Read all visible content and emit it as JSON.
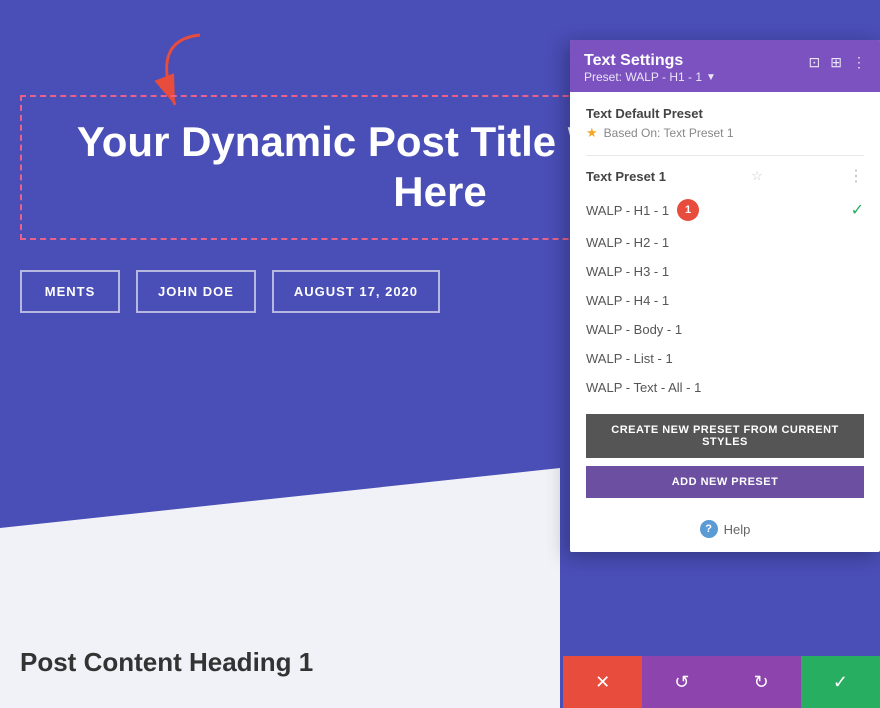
{
  "page": {
    "bg_color": "#4a4eb7"
  },
  "title": {
    "text": "Your Dynamic Post Title Will Display Here"
  },
  "meta": {
    "comments": "MENTS",
    "author": "JOHN DOE",
    "date": "AUGUST 17, 2020"
  },
  "post_content": {
    "heading": "Post Content Heading 1"
  },
  "panel": {
    "title": "Text Settings",
    "preset_label": "Preset: WALP - H1 - 1",
    "chevron": "▼",
    "default_preset": {
      "label": "Text Default Preset",
      "based_on": "Based On: Text Preset 1"
    },
    "presets_group_label": "Text Preset 1",
    "presets": [
      {
        "name": "WALP - H1 - 1",
        "active": true,
        "badge": "1"
      },
      {
        "name": "WALP - H2 - 1",
        "active": false
      },
      {
        "name": "WALP - H3 - 1",
        "active": false
      },
      {
        "name": "WALP - H4 - 1",
        "active": false
      },
      {
        "name": "WALP - Body - 1",
        "active": false
      },
      {
        "name": "WALP - List - 1",
        "active": false
      },
      {
        "name": "WALP - Text - All - 1",
        "active": false
      }
    ],
    "btn_create": "CREATE NEW PRESET FROM CURRENT STYLES",
    "btn_add": "ADD NEW PRESET",
    "help": "Help"
  },
  "toolbar": {
    "close": "✕",
    "undo": "↺",
    "redo": "↻",
    "save": "✓"
  }
}
